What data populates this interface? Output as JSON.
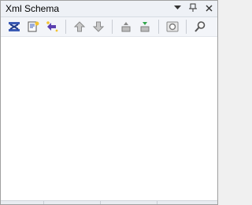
{
  "panel": {
    "title": "Xml Schema",
    "window_buttons": {
      "dropdown_icon": "chevron-down-icon",
      "pin_icon": "pin-icon",
      "close_icon": "close-icon"
    }
  },
  "toolbar": {
    "items": [
      {
        "name": "schema-overview-button",
        "icon": "schema-icon"
      },
      {
        "name": "open-schema-button",
        "icon": "open-file-icon"
      },
      {
        "name": "generate-schema-button",
        "icon": "magic-wand-icon"
      },
      {
        "name": "move-up-button",
        "icon": "arrow-up-icon"
      },
      {
        "name": "move-down-button",
        "icon": "arrow-down-icon"
      },
      {
        "name": "collapse-button",
        "icon": "collapse-icon"
      },
      {
        "name": "expand-button",
        "icon": "expand-icon"
      },
      {
        "name": "settings-button",
        "icon": "settings-icon"
      },
      {
        "name": "search-button",
        "icon": "search-icon"
      }
    ]
  }
}
